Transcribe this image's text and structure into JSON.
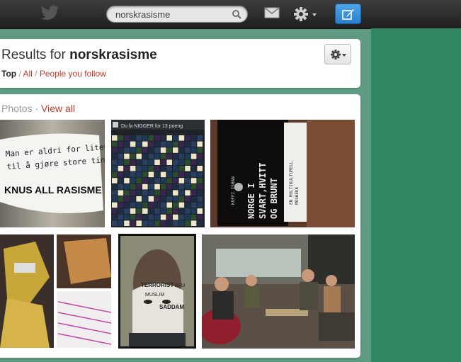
{
  "topbar": {
    "search_value": "norskrasisme"
  },
  "header": {
    "results_prefix": "Results for",
    "query": "norskrasisme",
    "filter_top": "Top",
    "filter_all": "All",
    "filter_people": "People you follow"
  },
  "photos": {
    "title": "Photos",
    "dot": "·",
    "view_all": "View all",
    "p1": {
      "line1": "Man er aldri for liten",
      "line2": "til å gjøre store ting",
      "line3": "KNUS ALL RASISME"
    },
    "p2": {
      "title": "Du la NIGGER for 13 poeng"
    },
    "p3": {
      "line1": "NORGE I",
      "line2": "SVART,HVITT",
      "line3": "OG BRUNT",
      "side1": "KOFFI ISHAN",
      "side2": "EN MULTIKULTURELL",
      "side3": "MOSBEKK"
    },
    "p5": {
      "w1": "TERRORIST",
      "w2": "RADI",
      "w3": "MUSLIM",
      "w4": "SADDAM"
    }
  },
  "colors": {
    "accent": "#c0392b",
    "background": "#5e9b82",
    "sidebar": "#2f8762",
    "compose": "#2a7fcf"
  }
}
